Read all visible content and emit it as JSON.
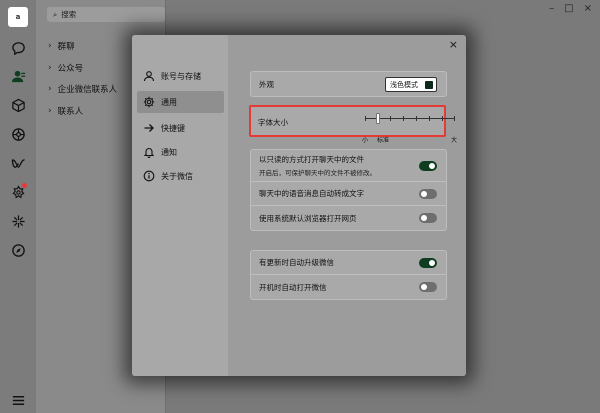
{
  "app": {
    "avatar_text": "a"
  },
  "search": {
    "placeholder": "搜索"
  },
  "contacts": [
    {
      "label": "群聊"
    },
    {
      "label": "公众号"
    },
    {
      "label": "企业微信联系人"
    },
    {
      "label": "联系人"
    }
  ],
  "dialog": {
    "nav": [
      {
        "label": "账号与存储",
        "icon": "user-icon"
      },
      {
        "label": "通用",
        "icon": "gear-icon"
      },
      {
        "label": "快捷键",
        "icon": "arrow-right-icon"
      },
      {
        "label": "通知",
        "icon": "bell-icon"
      },
      {
        "label": "关于微信",
        "icon": "info-icon"
      }
    ],
    "active_nav": "通用",
    "appearance": {
      "label": "外观",
      "value": "浅色模式"
    },
    "font_size": {
      "label": "字体大小",
      "min_label": "小",
      "mid_label": "标准",
      "max_label": "大",
      "level": 1,
      "steps": 8
    },
    "file_section": [
      {
        "label": "以只读的方式打开聊天中的文件",
        "sub": "开启后，可保护聊天中的文件不被修改。",
        "on": true
      },
      {
        "label": "聊天中的语音消息自动转成文字",
        "on": false
      },
      {
        "label": "使用系统默认浏览器打开网页",
        "on": false
      }
    ],
    "update_section": [
      {
        "label": "有更新时自动升级微信",
        "on": true
      },
      {
        "label": "开机时自动打开微信",
        "on": false
      }
    ]
  },
  "colors": {
    "accent": "#0f3d1f",
    "highlight": "#e53935"
  }
}
